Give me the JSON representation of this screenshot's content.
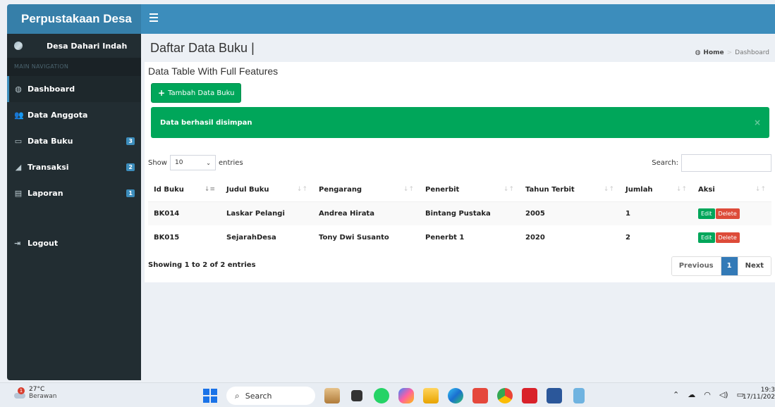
{
  "brand": "Perpustakaan Desa",
  "sidebar": {
    "user_name": "Desa Dahari Indah",
    "nav_header": "MAIN NAVIGATION",
    "items": [
      {
        "label": "Dashboard",
        "icon": "dashboard-icon",
        "badge": ""
      },
      {
        "label": "Data Anggota",
        "icon": "users-icon",
        "badge": ""
      },
      {
        "label": "Data Buku",
        "icon": "desktop-icon",
        "badge": "3"
      },
      {
        "label": "Transaksi",
        "icon": "chart-area-icon",
        "badge": "2"
      },
      {
        "label": "Laporan",
        "icon": "file-icon",
        "badge": "1"
      }
    ],
    "logout": "Logout"
  },
  "header": {
    "title": "Daftar Data Buku |",
    "breadcrumb_home": "Home",
    "breadcrumb_sep": ">",
    "breadcrumb_current": "Dashboard"
  },
  "box": {
    "title": "Data Table With Full Features",
    "add_button": "Tambah Data Buku",
    "alert": "Data berhasil disimpan",
    "alert_close": "×",
    "show_label": "Show",
    "entries_value": "10",
    "entries_label": "entries",
    "search_label": "Search:",
    "search_value": "",
    "columns": [
      "Id Buku",
      "Judul Buku",
      "Pengarang",
      "Penerbit",
      "Tahun Terbit",
      "Jumlah",
      "Aksi"
    ],
    "rows": [
      {
        "id": "BK014",
        "judul": "Laskar Pelangi",
        "pengarang": "Andrea Hirata",
        "penerbit": "Bintang Pustaka",
        "tahun": "2005",
        "jumlah": "1"
      },
      {
        "id": "BK015",
        "judul": "SejarahDesa",
        "pengarang": "Tony Dwi Susanto",
        "penerbit": "Penerbt 1",
        "tahun": "2020",
        "jumlah": "2"
      }
    ],
    "edit_label": "Edit",
    "delete_label": "Delete",
    "info": "Showing 1 to 2 of 2 entries",
    "pager": {
      "prev": "Previous",
      "current": "1",
      "next": "Next"
    }
  },
  "taskbar": {
    "temperature": "27°C",
    "weather": "Berawan",
    "weather_badge": "1",
    "search": "Search",
    "time": "19:3",
    "date": "17/11/202",
    "apps": [
      "deer-app-icon",
      "black-app-icon",
      "whatsapp-icon",
      "copilot-icon",
      "file-explorer-icon",
      "edge-icon",
      "office-icon",
      "chrome-icon",
      "red-app-icon",
      "word-icon",
      "notepad-icon"
    ]
  },
  "colors": {
    "brand_dark": "#367fa9",
    "header_blue": "#3c8dbc",
    "sidebar_bg": "#222d32",
    "success": "#00a65a",
    "danger": "#dd4b39",
    "primary": "#337ab7"
  }
}
